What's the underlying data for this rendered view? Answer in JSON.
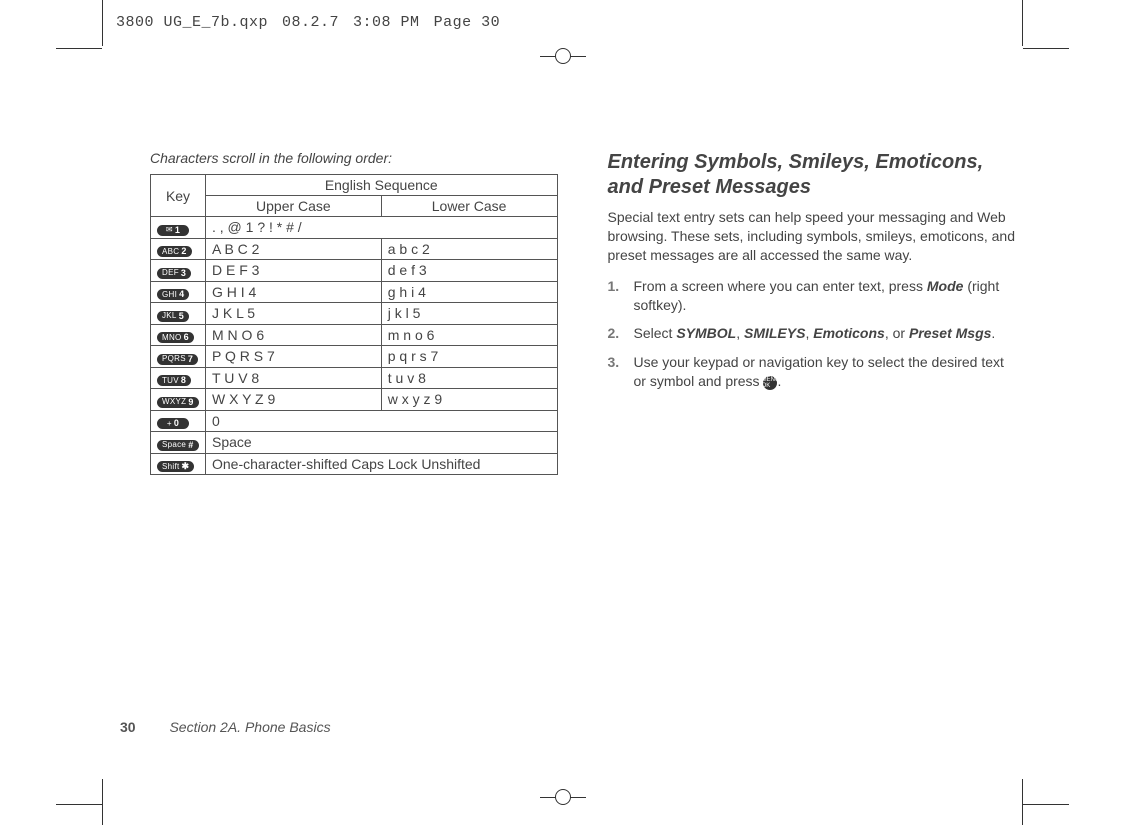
{
  "header": {
    "file": "3800 UG_E_7b.qxp",
    "date": "08.2.7",
    "time": "3:08 PM",
    "page": "Page 30"
  },
  "left": {
    "intro": "Characters scroll in the following order:",
    "table": {
      "headers": {
        "key": "Key",
        "seq": "English Sequence",
        "upper": "Upper Case",
        "lower": "Lower Case"
      },
      "rows": [
        {
          "keyLabel": "✉",
          "keyNum": "1",
          "upper": ". , @ 1 ? ! * # /",
          "lower": "",
          "span": true
        },
        {
          "keyLabel": "ABC",
          "keyNum": "2",
          "upper": "A B C 2",
          "lower": "a b c 2"
        },
        {
          "keyLabel": "DEF",
          "keyNum": "3",
          "upper": "D E F 3",
          "lower": "d e f 3"
        },
        {
          "keyLabel": "GHI",
          "keyNum": "4",
          "upper": "G H I 4",
          "lower": "g h i 4"
        },
        {
          "keyLabel": "JKL",
          "keyNum": "5",
          "upper": "J K L 5",
          "lower": "j k l 5"
        },
        {
          "keyLabel": "MNO",
          "keyNum": "6",
          "upper": "M N O 6",
          "lower": "m n o 6"
        },
        {
          "keyLabel": "PQRS",
          "keyNum": "7",
          "upper": "P Q R S 7",
          "lower": "p q r s 7"
        },
        {
          "keyLabel": "TUV",
          "keyNum": "8",
          "upper": "T U V 8",
          "lower": "t u v 8"
        },
        {
          "keyLabel": "WXYZ",
          "keyNum": "9",
          "upper": "W X Y Z 9",
          "lower": "w x y z 9"
        },
        {
          "keyLabel": "+",
          "keyNum": "0",
          "upper": "0",
          "lower": "",
          "span": true
        },
        {
          "keyLabel": "Space",
          "keyNum": "#",
          "upper": "Space",
          "lower": "",
          "span": true
        },
        {
          "keyLabel": "Shift",
          "keyNum": "✱",
          "upper": "One-character-shifted   Caps Lock   Unshifted",
          "lower": "",
          "span": true
        }
      ]
    }
  },
  "right": {
    "heading": "Entering Symbols, Smileys, Emoticons, and Preset Messages",
    "paragraph": "Special text entry sets can help speed your messaging and Web browsing. These sets, including symbols, smileys, emoticons, and preset messages are all accessed the same way.",
    "steps": [
      {
        "num": "1.",
        "pre": "From a screen where you can enter text, press ",
        "bold1": "Mode",
        "post": " (right softkey)."
      },
      {
        "num": "2.",
        "pre": "Select ",
        "b1": "SYMBOL",
        "c1": ", ",
        "b2": "SMILEYS",
        "c2": ", ",
        "b3": "Emoticons",
        "c3": ", or ",
        "b4": "Preset Msgs",
        "post": "."
      },
      {
        "num": "3.",
        "pre": "Use your keypad or navigation key to select the desired text or symbol and press ",
        "post": "."
      }
    ]
  },
  "footer": {
    "page": "30",
    "section": "Section 2A. Phone Basics"
  }
}
